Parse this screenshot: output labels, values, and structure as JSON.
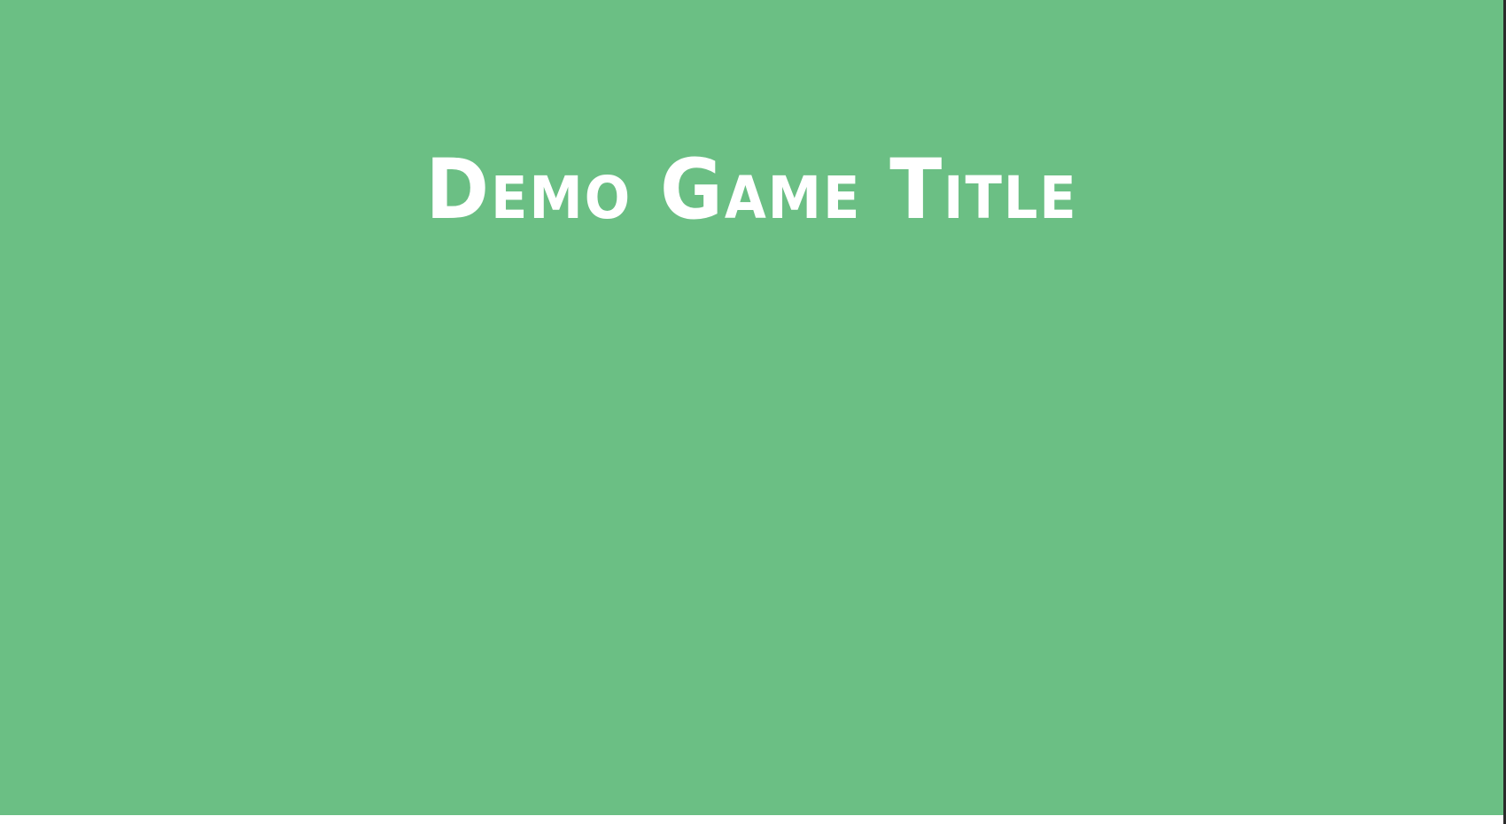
{
  "game": {
    "title": "Demo Game Title"
  },
  "colors": {
    "background": "#6bbf84",
    "title_text": "#ffffff"
  }
}
